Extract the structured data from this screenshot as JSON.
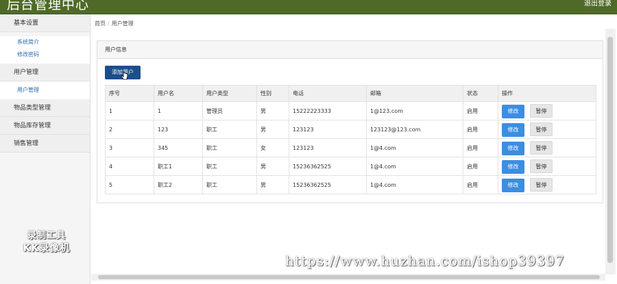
{
  "header": {
    "title": "后台管理中心",
    "logout": "退出登录"
  },
  "sidebar": {
    "groups": [
      {
        "label": "基本设置",
        "items": [
          "系统简介",
          "修改密码"
        ]
      },
      {
        "label": "用户管理",
        "items": [
          "用户管理"
        ]
      },
      {
        "label": "物品类型管理",
        "items": []
      },
      {
        "label": "物品库存管理",
        "items": []
      },
      {
        "label": "销售管理",
        "items": []
      }
    ]
  },
  "watermark_logo": {
    "line1": "录制工具",
    "line2": "KK录像机"
  },
  "breadcrumb": {
    "home": "首页",
    "current": "用户管理"
  },
  "panel": {
    "title": "用户信息",
    "add_button": "添加用户"
  },
  "table": {
    "headers": [
      "序号",
      "用户名",
      "用户类型",
      "性别",
      "电话",
      "邮箱",
      "状态",
      "操作"
    ],
    "rows": [
      {
        "id": "1",
        "username": "1",
        "type": "管理员",
        "gender": "男",
        "phone": "15222223333",
        "email": "1@123.com",
        "status": "启用"
      },
      {
        "id": "2",
        "username": "123",
        "type": "职工",
        "gender": "男",
        "phone": "123123",
        "email": "123123@123.com",
        "status": "启用"
      },
      {
        "id": "3",
        "username": "345",
        "type": "职工",
        "gender": "女",
        "phone": "123123",
        "email": "1@4.com",
        "status": "启用"
      },
      {
        "id": "4",
        "username": "职工1",
        "type": "职工",
        "gender": "男",
        "phone": "15236362525",
        "email": "1@4.com",
        "status": "启用"
      },
      {
        "id": "5",
        "username": "职工2",
        "type": "职工",
        "gender": "男",
        "phone": "15236362525",
        "email": "1@4.com",
        "status": "启用"
      }
    ],
    "edit_label": "修改",
    "stop_label": "暂停"
  },
  "url_watermark": "https://www.huzhan.com/ishop39397",
  "colors": {
    "header_bg": "#4f6a28",
    "primary_btn": "#1a4f8b",
    "edit_btn": "#3d8de0"
  }
}
